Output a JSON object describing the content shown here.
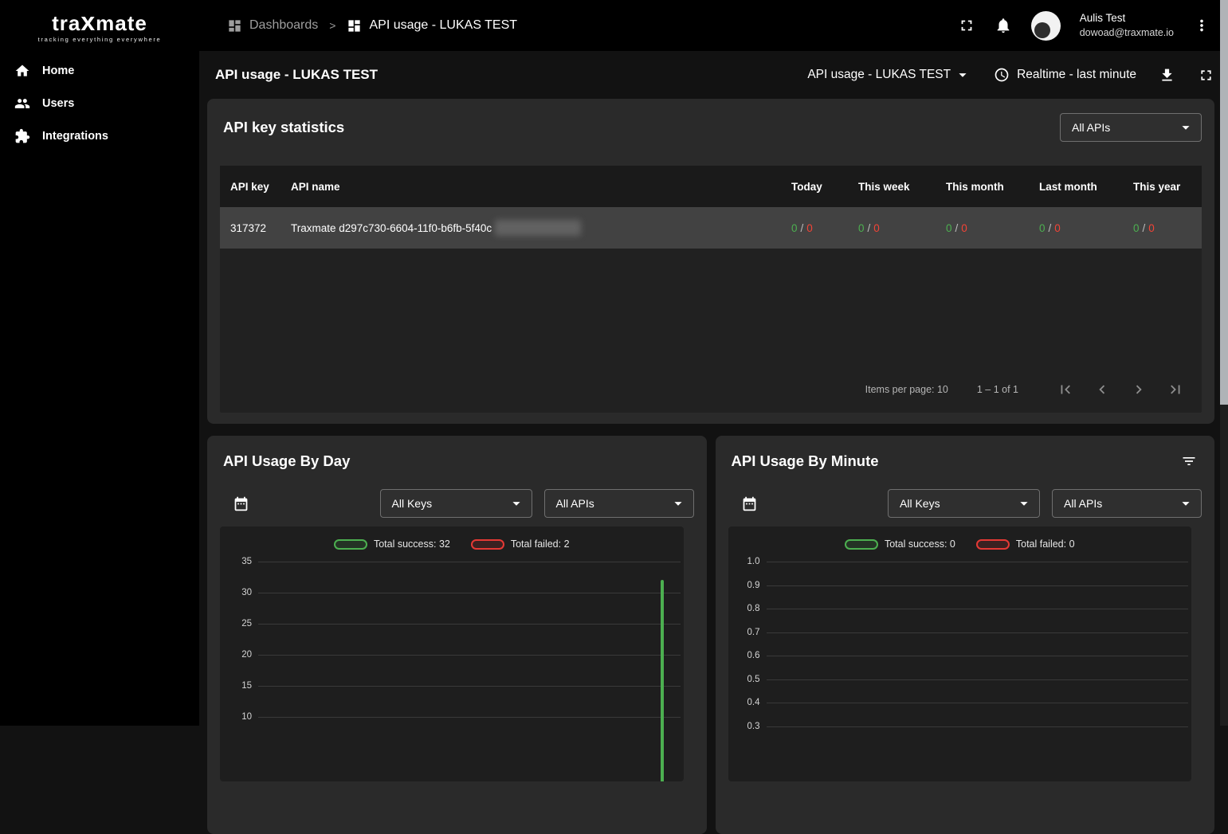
{
  "topbar": {
    "logo_tra": "tra",
    "logo_x": "x",
    "logo_mate": "mate",
    "tagline": "tracking everything everywhere",
    "breadcrumb": {
      "dashboards": "Dashboards",
      "separator": ">",
      "current": "API usage - LUKAS TEST"
    },
    "user": {
      "name": "Aulis Test",
      "email": "dowoad@traxmate.io"
    }
  },
  "sidebar": {
    "items": [
      {
        "label": "Home"
      },
      {
        "label": "Users"
      },
      {
        "label": "Integrations"
      }
    ]
  },
  "page_header": {
    "title": "API usage - LUKAS TEST",
    "dashboard_selector": "API usage - LUKAS TEST",
    "realtime_label": "Realtime - last minute"
  },
  "common": {
    "slash": "/"
  },
  "stats_card": {
    "title": "API key statistics",
    "api_filter_value": "All APIs",
    "table": {
      "headers": {
        "key": "API key",
        "name": "API name",
        "today": "Today",
        "week": "This week",
        "month": "This month",
        "last_month": "Last month",
        "year": "This year"
      },
      "rows": [
        {
          "key": "317372",
          "name": "Traxmate d297c730-6604-11f0-b6fb-5f40c",
          "today": {
            "success": "0",
            "failed": "0"
          },
          "week": {
            "success": "0",
            "failed": "0"
          },
          "month": {
            "success": "0",
            "failed": "0"
          },
          "last_month": {
            "success": "0",
            "failed": "0"
          },
          "year": {
            "success": "0",
            "failed": "0"
          }
        }
      ]
    },
    "pagination": {
      "items_per_page_label": "Items per page: 10",
      "range_label": "1 – 1 of 1"
    }
  },
  "day_card": {
    "title": "API Usage By Day",
    "keys_filter_value": "All Keys",
    "apis_filter_value": "All APIs"
  },
  "minute_card": {
    "title": "API Usage By Minute",
    "keys_filter_value": "All Keys",
    "apis_filter_value": "All APIs"
  },
  "chart_data": [
    {
      "type": "line",
      "title": "API Usage By Day",
      "legend": [
        {
          "label": "Total success: 32",
          "color": "#4caf50"
        },
        {
          "label": "Total failed: 2",
          "color": "#e53935"
        }
      ],
      "total_success": 32,
      "total_failed": 2,
      "ytick_labels": [
        "35",
        "30",
        "25",
        "20",
        "15",
        "10"
      ],
      "ylim_visible": [
        10,
        35
      ],
      "grid": true,
      "legend_position": "top",
      "series": [
        {
          "name": "success",
          "color": "#4caf50",
          "points": [
            {
              "x_frac": 0.958,
              "y": 32
            }
          ]
        },
        {
          "name": "failed",
          "color": "#e53935",
          "points": []
        }
      ]
    },
    {
      "type": "line",
      "title": "API Usage By Minute",
      "legend": [
        {
          "label": "Total success: 0",
          "color": "#4caf50"
        },
        {
          "label": "Total failed: 0",
          "color": "#e53935"
        }
      ],
      "total_success": 0,
      "total_failed": 0,
      "ytick_labels": [
        "1.0",
        "0.9",
        "0.8",
        "0.7",
        "0.6",
        "0.5",
        "0.4",
        "0.3"
      ],
      "ylim_visible": [
        0.3,
        1.0
      ],
      "grid": true,
      "legend_position": "top",
      "series": []
    }
  ]
}
